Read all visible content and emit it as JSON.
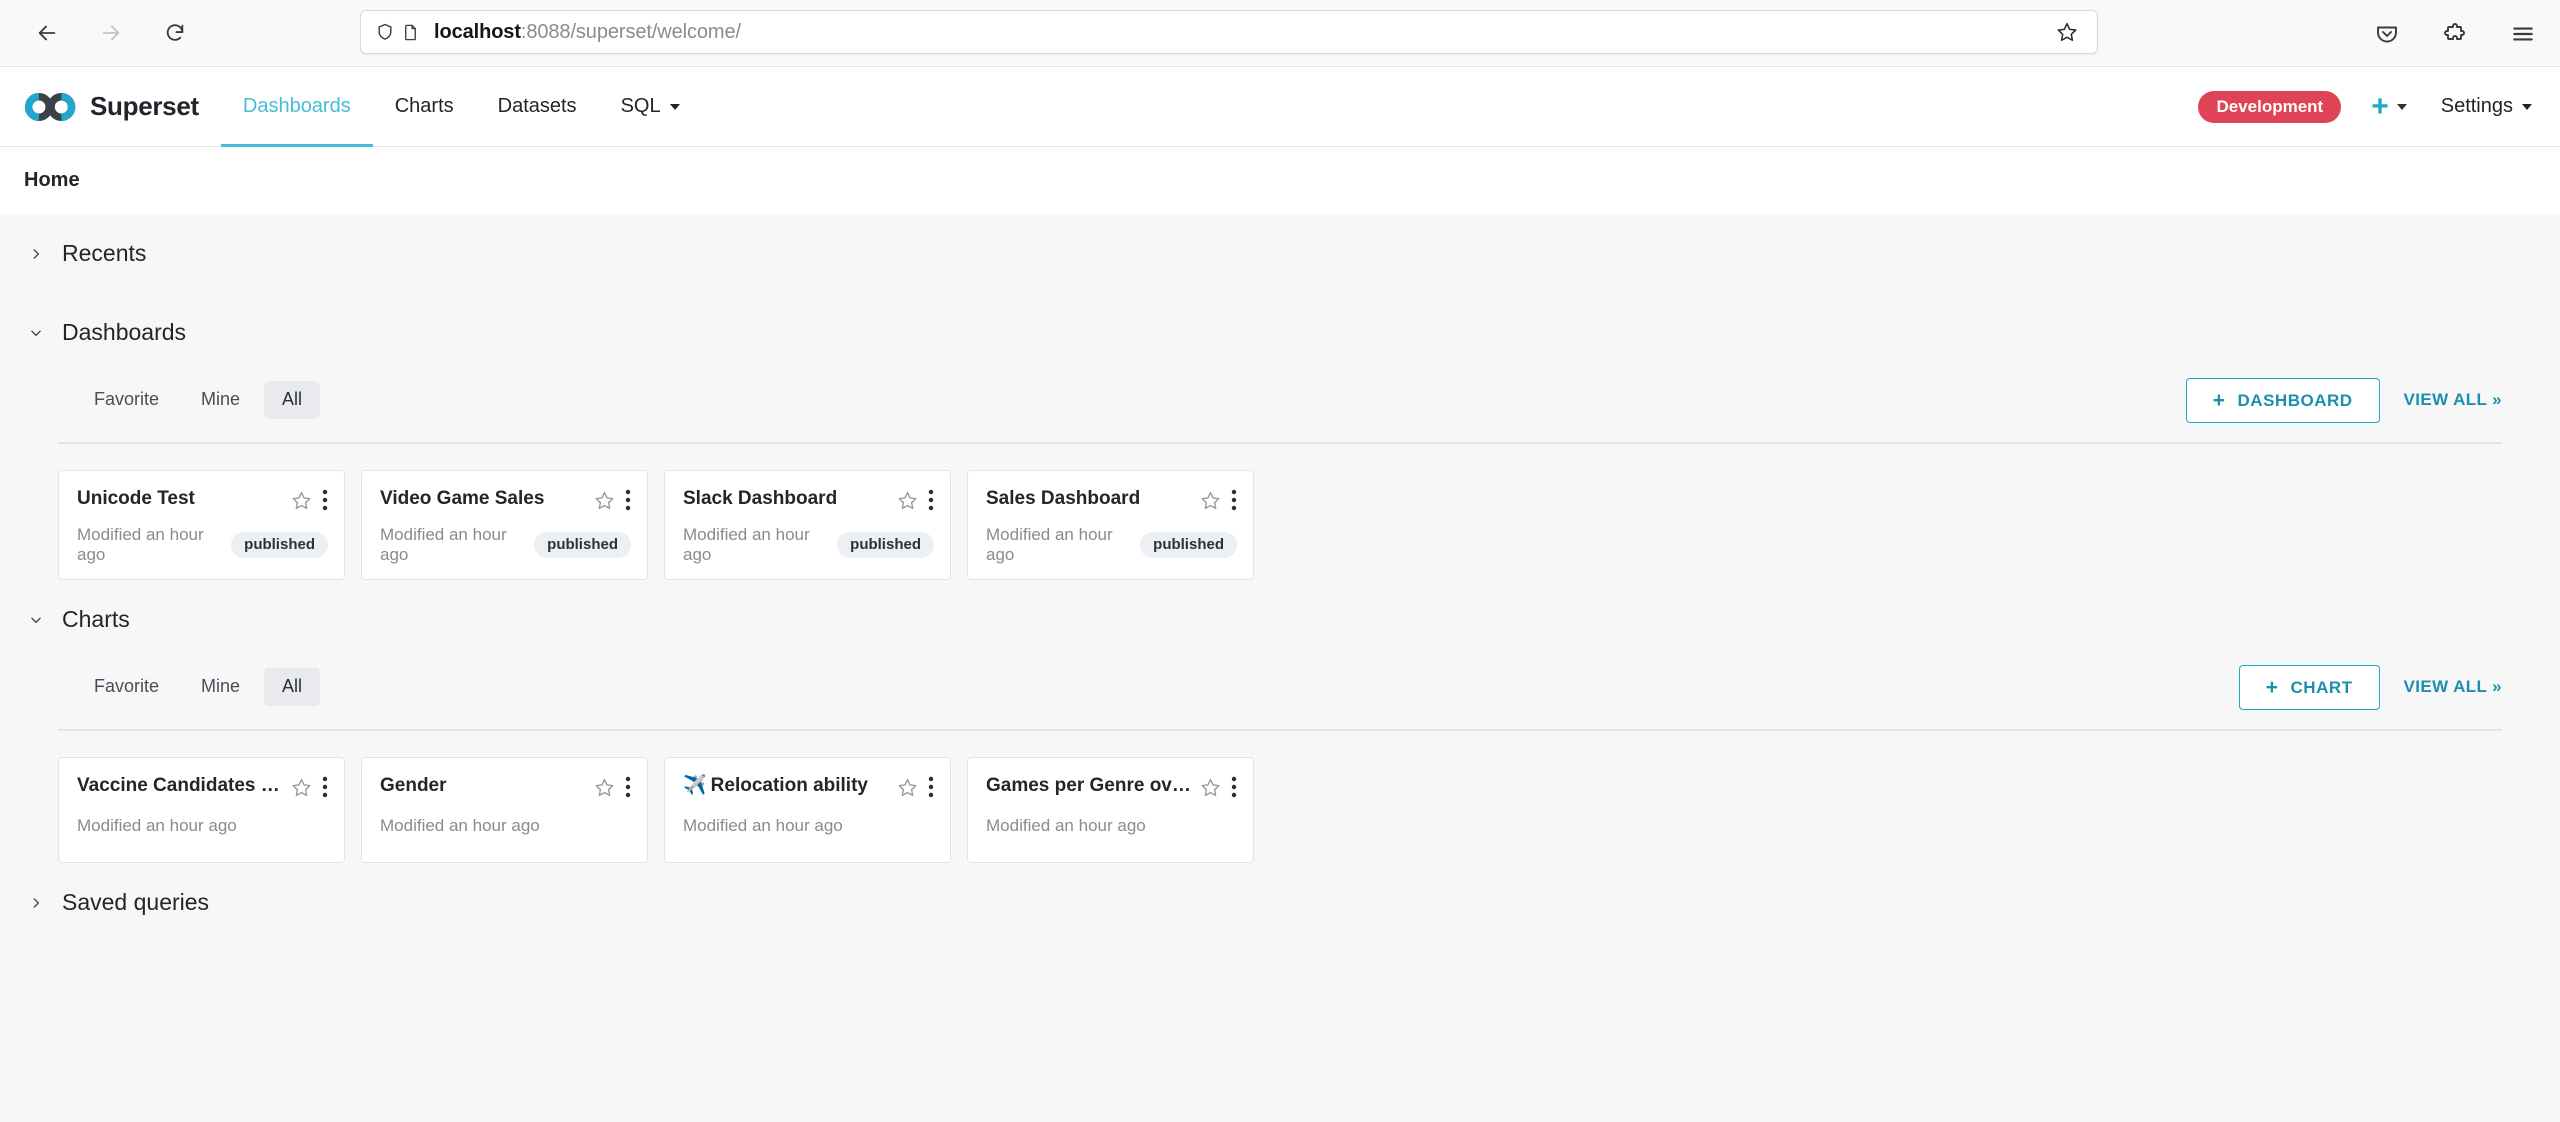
{
  "browser": {
    "back_label": "Back",
    "forward_label": "Forward",
    "reload_label": "Reload",
    "url_host": "localhost",
    "url_rest": ":8088/superset/welcome/",
    "bookmark_label": "Bookmark this page",
    "pocket_label": "Save to Pocket",
    "extensions_label": "Extensions",
    "menu_label": "Open application menu"
  },
  "navbar": {
    "brand": "Superset",
    "links": [
      {
        "label": "Dashboards",
        "active": true,
        "caret": false
      },
      {
        "label": "Charts",
        "active": false,
        "caret": false
      },
      {
        "label": "Datasets",
        "active": false,
        "caret": false
      },
      {
        "label": "SQL",
        "active": false,
        "caret": true
      }
    ],
    "env_badge": "Development",
    "plus_label": "+",
    "settings_label": "Settings",
    "accent_color": "#20a7c9",
    "active_link_color": "#45bed6",
    "badge_color": "#e04355"
  },
  "page": {
    "title": "Home"
  },
  "sections": [
    {
      "id": "recents",
      "title": "Recents",
      "expanded": false
    },
    {
      "id": "dashboards",
      "title": "Dashboards",
      "expanded": true,
      "tabs": [
        {
          "label": "Favorite",
          "active": false
        },
        {
          "label": "Mine",
          "active": false
        },
        {
          "label": "All",
          "active": true
        }
      ],
      "create_button": "DASHBOARD",
      "view_all": "VIEW ALL »",
      "cards": [
        {
          "title": "Unicode Test",
          "modified": "Modified an hour ago",
          "status": "published"
        },
        {
          "title": "Video Game Sales",
          "modified": "Modified an hour ago",
          "status": "published"
        },
        {
          "title": "Slack Dashboard",
          "modified": "Modified an hour ago",
          "status": "published"
        },
        {
          "title": "Sales Dashboard",
          "modified": "Modified an hour ago",
          "status": "published"
        }
      ]
    },
    {
      "id": "charts",
      "title": "Charts",
      "expanded": true,
      "tabs": [
        {
          "label": "Favorite",
          "active": false
        },
        {
          "label": "Mine",
          "active": false
        },
        {
          "label": "All",
          "active": true
        }
      ],
      "create_button": "CHART",
      "view_all": "VIEW ALL »",
      "cards": [
        {
          "title": "Vaccine Candidates per C…",
          "modified": "Modified an hour ago",
          "emoji": ""
        },
        {
          "title": "Gender",
          "modified": "Modified an hour ago",
          "emoji": ""
        },
        {
          "title": "Relocation ability",
          "modified": "Modified an hour ago",
          "emoji": "✈️"
        },
        {
          "title": "Games per Genre over time",
          "modified": "Modified an hour ago",
          "emoji": ""
        }
      ]
    },
    {
      "id": "saved-queries",
      "title": "Saved queries",
      "expanded": false
    }
  ]
}
